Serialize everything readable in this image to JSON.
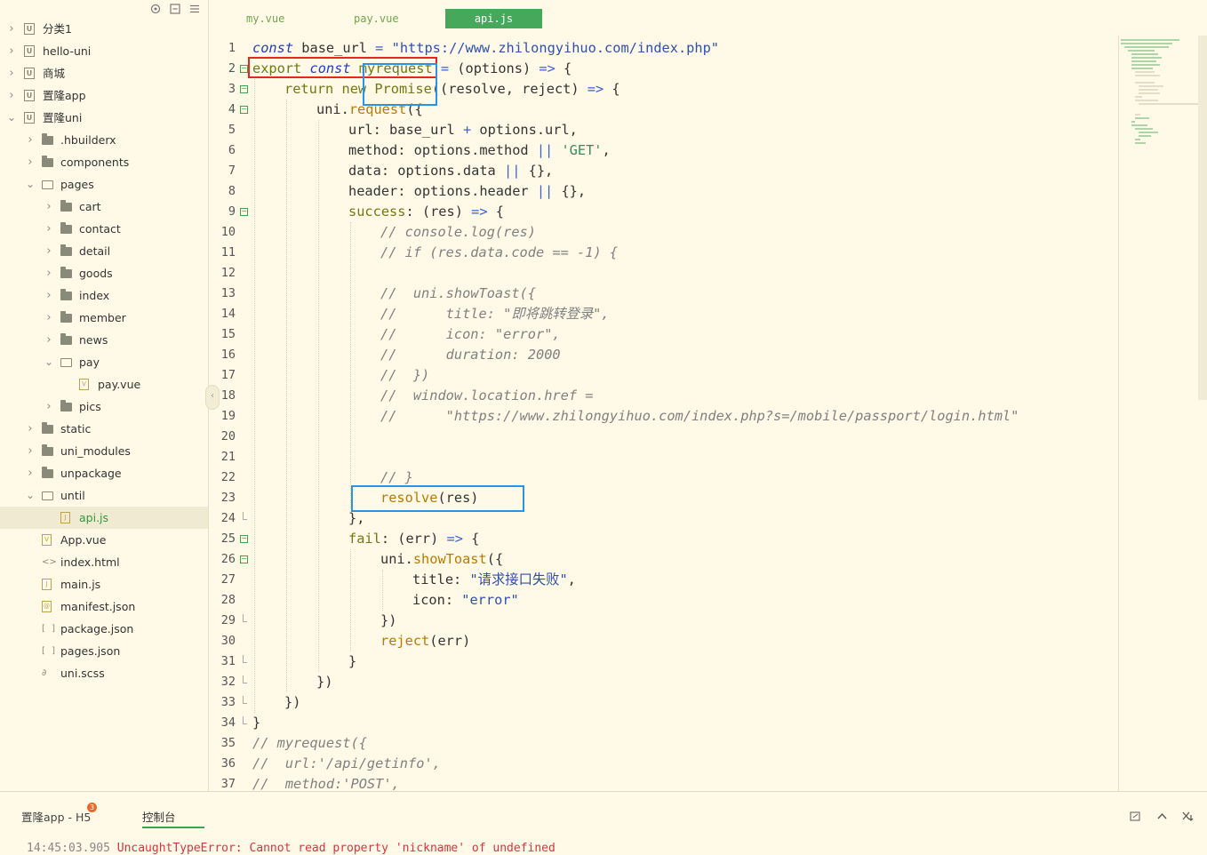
{
  "tabs": [
    {
      "label": "my.vue",
      "active": false
    },
    {
      "label": "pay.vue",
      "active": false
    },
    {
      "label": "api.js",
      "active": true
    }
  ],
  "tree": [
    {
      "label": "分类1",
      "depth": 0,
      "type": "project",
      "open": false
    },
    {
      "label": "hello-uni",
      "depth": 0,
      "type": "project",
      "open": false
    },
    {
      "label": "商城",
      "depth": 0,
      "type": "project",
      "open": false
    },
    {
      "label": "置隆app",
      "depth": 0,
      "type": "project",
      "open": false
    },
    {
      "label": "置隆uni",
      "depth": 0,
      "type": "project",
      "open": true
    },
    {
      "label": ".hbuilderx",
      "depth": 1,
      "type": "folder",
      "open": false
    },
    {
      "label": "components",
      "depth": 1,
      "type": "folder",
      "open": false
    },
    {
      "label": "pages",
      "depth": 1,
      "type": "folder",
      "open": true
    },
    {
      "label": "cart",
      "depth": 2,
      "type": "folder",
      "open": false
    },
    {
      "label": "contact",
      "depth": 2,
      "type": "folder",
      "open": false
    },
    {
      "label": "detail",
      "depth": 2,
      "type": "folder",
      "open": false
    },
    {
      "label": "goods",
      "depth": 2,
      "type": "folder",
      "open": false
    },
    {
      "label": "index",
      "depth": 2,
      "type": "folder",
      "open": false
    },
    {
      "label": "member",
      "depth": 2,
      "type": "folder",
      "open": false
    },
    {
      "label": "news",
      "depth": 2,
      "type": "folder",
      "open": false
    },
    {
      "label": "pay",
      "depth": 2,
      "type": "folder",
      "open": true
    },
    {
      "label": "pay.vue",
      "depth": 3,
      "type": "vue"
    },
    {
      "label": "pics",
      "depth": 2,
      "type": "folder",
      "open": false
    },
    {
      "label": "static",
      "depth": 1,
      "type": "folder",
      "open": false
    },
    {
      "label": "uni_modules",
      "depth": 1,
      "type": "folder",
      "open": false
    },
    {
      "label": "unpackage",
      "depth": 1,
      "type": "folder",
      "open": false
    },
    {
      "label": "until",
      "depth": 1,
      "type": "folder",
      "open": true
    },
    {
      "label": "api.js",
      "depth": 2,
      "type": "js",
      "selected": true
    },
    {
      "label": "App.vue",
      "depth": 1,
      "type": "vue"
    },
    {
      "label": "index.html",
      "depth": 1,
      "type": "html"
    },
    {
      "label": "main.js",
      "depth": 1,
      "type": "js"
    },
    {
      "label": "manifest.json",
      "depth": 1,
      "type": "manifest"
    },
    {
      "label": "package.json",
      "depth": 1,
      "type": "json"
    },
    {
      "label": "pages.json",
      "depth": 1,
      "type": "json"
    },
    {
      "label": "uni.scss",
      "depth": 1,
      "type": "scss"
    }
  ],
  "code_lines": [
    {
      "n": "1",
      "fold": "",
      "indent": 0,
      "tokens": [
        [
          "kw",
          "const"
        ],
        [
          "plain",
          " base_url "
        ],
        [
          "op",
          "="
        ],
        [
          "plain",
          " "
        ],
        [
          "str",
          "\"https://www.zhilongyihuo.com/index.php\""
        ]
      ]
    },
    {
      "n": "2",
      "fold": "open",
      "indent": 0,
      "tokens": [
        [
          "ky",
          "export"
        ],
        [
          "plain",
          " "
        ],
        [
          "kw",
          "const"
        ],
        [
          "plain",
          " "
        ],
        [
          "ky",
          "myrequest"
        ],
        [
          "plain",
          " "
        ],
        [
          "op",
          "="
        ],
        [
          "plain",
          " (options) "
        ],
        [
          "op",
          "=>"
        ],
        [
          "plain",
          " {"
        ]
      ]
    },
    {
      "n": "3",
      "fold": "open",
      "indent": 1,
      "tokens": [
        [
          "ky",
          "return"
        ],
        [
          "plain",
          " "
        ],
        [
          "ky",
          "new"
        ],
        [
          "plain",
          " "
        ],
        [
          "ky",
          "Promise"
        ],
        [
          "plain",
          "((resolve, reject) "
        ],
        [
          "op",
          "=>"
        ],
        [
          "plain",
          " {"
        ]
      ]
    },
    {
      "n": "4",
      "fold": "open",
      "indent": 2,
      "tokens": [
        [
          "plain",
          "uni."
        ],
        [
          "fn",
          "request"
        ],
        [
          "plain",
          "({"
        ]
      ]
    },
    {
      "n": "5",
      "fold": "",
      "indent": 3,
      "tokens": [
        [
          "plain",
          "url: base_url "
        ],
        [
          "op",
          "+"
        ],
        [
          "plain",
          " options.url,"
        ]
      ]
    },
    {
      "n": "6",
      "fold": "",
      "indent": 3,
      "tokens": [
        [
          "plain",
          "method: options.method "
        ],
        [
          "op",
          "||"
        ],
        [
          "plain",
          " "
        ],
        [
          "str2",
          "'GET'"
        ],
        [
          "plain",
          ","
        ]
      ]
    },
    {
      "n": "7",
      "fold": "",
      "indent": 3,
      "tokens": [
        [
          "plain",
          "data: options.data "
        ],
        [
          "op",
          "||"
        ],
        [
          "plain",
          " {},"
        ]
      ]
    },
    {
      "n": "8",
      "fold": "",
      "indent": 3,
      "tokens": [
        [
          "plain",
          "header: options.header "
        ],
        [
          "op",
          "||"
        ],
        [
          "plain",
          " {},"
        ]
      ]
    },
    {
      "n": "9",
      "fold": "open",
      "indent": 3,
      "tokens": [
        [
          "ky",
          "success"
        ],
        [
          "plain",
          ": (res) "
        ],
        [
          "op",
          "=>"
        ],
        [
          "plain",
          " {"
        ]
      ]
    },
    {
      "n": "10",
      "fold": "",
      "indent": 4,
      "tokens": [
        [
          "cm",
          "// console.log(res)"
        ]
      ]
    },
    {
      "n": "11",
      "fold": "",
      "indent": 4,
      "tokens": [
        [
          "cm",
          "// if (res.data.code == -1) {"
        ]
      ]
    },
    {
      "n": "12",
      "fold": "",
      "indent": 4,
      "tokens": []
    },
    {
      "n": "13",
      "fold": "",
      "indent": 4,
      "tokens": [
        [
          "cm",
          "//  uni.showToast({"
        ]
      ]
    },
    {
      "n": "14",
      "fold": "",
      "indent": 4,
      "tokens": [
        [
          "cm",
          "//      title: \"即将跳转登录\","
        ]
      ]
    },
    {
      "n": "15",
      "fold": "",
      "indent": 4,
      "tokens": [
        [
          "cm",
          "//      icon: \"error\","
        ]
      ]
    },
    {
      "n": "16",
      "fold": "",
      "indent": 4,
      "tokens": [
        [
          "cm",
          "//      duration: 2000"
        ]
      ]
    },
    {
      "n": "17",
      "fold": "",
      "indent": 4,
      "tokens": [
        [
          "cm",
          "//  })"
        ]
      ]
    },
    {
      "n": "18",
      "fold": "",
      "indent": 4,
      "tokens": [
        [
          "cm",
          "//  window.location.href ="
        ]
      ]
    },
    {
      "n": "19",
      "fold": "",
      "indent": 4,
      "tokens": [
        [
          "cm",
          "//      \"https://www.zhilongyihuo.com/index.php?s=/mobile/passport/login.html\""
        ]
      ]
    },
    {
      "n": "20",
      "fold": "",
      "indent": 4,
      "tokens": []
    },
    {
      "n": "21",
      "fold": "",
      "indent": 4,
      "tokens": []
    },
    {
      "n": "22",
      "fold": "",
      "indent": 4,
      "tokens": [
        [
          "cm",
          "// }"
        ]
      ]
    },
    {
      "n": "23",
      "fold": "",
      "indent": 4,
      "tokens": [
        [
          "fn",
          "resolve"
        ],
        [
          "plain",
          "(res)"
        ]
      ]
    },
    {
      "n": "24",
      "fold": "end",
      "indent": 3,
      "tokens": [
        [
          "plain",
          "},"
        ]
      ]
    },
    {
      "n": "25",
      "fold": "open",
      "indent": 3,
      "tokens": [
        [
          "ky",
          "fail"
        ],
        [
          "plain",
          ": (err) "
        ],
        [
          "op",
          "=>"
        ],
        [
          "plain",
          " {"
        ]
      ]
    },
    {
      "n": "26",
      "fold": "open",
      "indent": 4,
      "tokens": [
        [
          "plain",
          "uni."
        ],
        [
          "fn",
          "showToast"
        ],
        [
          "plain",
          "({"
        ]
      ]
    },
    {
      "n": "27",
      "fold": "",
      "indent": 5,
      "tokens": [
        [
          "plain",
          "title: "
        ],
        [
          "str",
          "\"请求接口失败\""
        ],
        [
          "plain",
          ","
        ]
      ]
    },
    {
      "n": "28",
      "fold": "",
      "indent": 5,
      "tokens": [
        [
          "plain",
          "icon: "
        ],
        [
          "str",
          "\"error\""
        ]
      ]
    },
    {
      "n": "29",
      "fold": "end",
      "indent": 4,
      "tokens": [
        [
          "plain",
          "})"
        ]
      ]
    },
    {
      "n": "30",
      "fold": "",
      "indent": 4,
      "tokens": [
        [
          "fn",
          "reject"
        ],
        [
          "plain",
          "(err)"
        ]
      ]
    },
    {
      "n": "31",
      "fold": "end",
      "indent": 3,
      "tokens": [
        [
          "plain",
          "}"
        ]
      ]
    },
    {
      "n": "32",
      "fold": "end",
      "indent": 2,
      "tokens": [
        [
          "plain",
          "})"
        ]
      ]
    },
    {
      "n": "33",
      "fold": "end",
      "indent": 1,
      "tokens": [
        [
          "plain",
          "})"
        ]
      ]
    },
    {
      "n": "34",
      "fold": "end",
      "indent": 0,
      "tokens": [
        [
          "plain",
          "}"
        ]
      ]
    },
    {
      "n": "35",
      "fold": "",
      "indent": 0,
      "tokens": [
        [
          "cm",
          "// myrequest({"
        ]
      ]
    },
    {
      "n": "36",
      "fold": "",
      "indent": 0,
      "tokens": [
        [
          "cm",
          "//  url:'/api/getinfo',"
        ]
      ]
    },
    {
      "n": "37",
      "fold": "",
      "indent": 0,
      "tokens": [
        [
          "cm",
          "//  method:'POST',"
        ]
      ]
    }
  ],
  "bottom": {
    "run_tab": "置隆app - H5",
    "badge": "3",
    "console_tab": "控制台",
    "console_time": "14:45:03.905",
    "console_error": "UncaughtTypeError: Cannot read property 'nickname' of undefined"
  },
  "colors": {
    "accent": "#46a85a",
    "red_box": "#e8251e",
    "blue_box": "#2a93e6",
    "error_text": "#d9333f"
  },
  "icons": {
    "side_tools": [
      "target-icon",
      "collapse-all-icon",
      "menu-icon"
    ],
    "bottom_tools": [
      "clear-console-icon",
      "chevron-up-icon",
      "close-panel-icon"
    ]
  }
}
